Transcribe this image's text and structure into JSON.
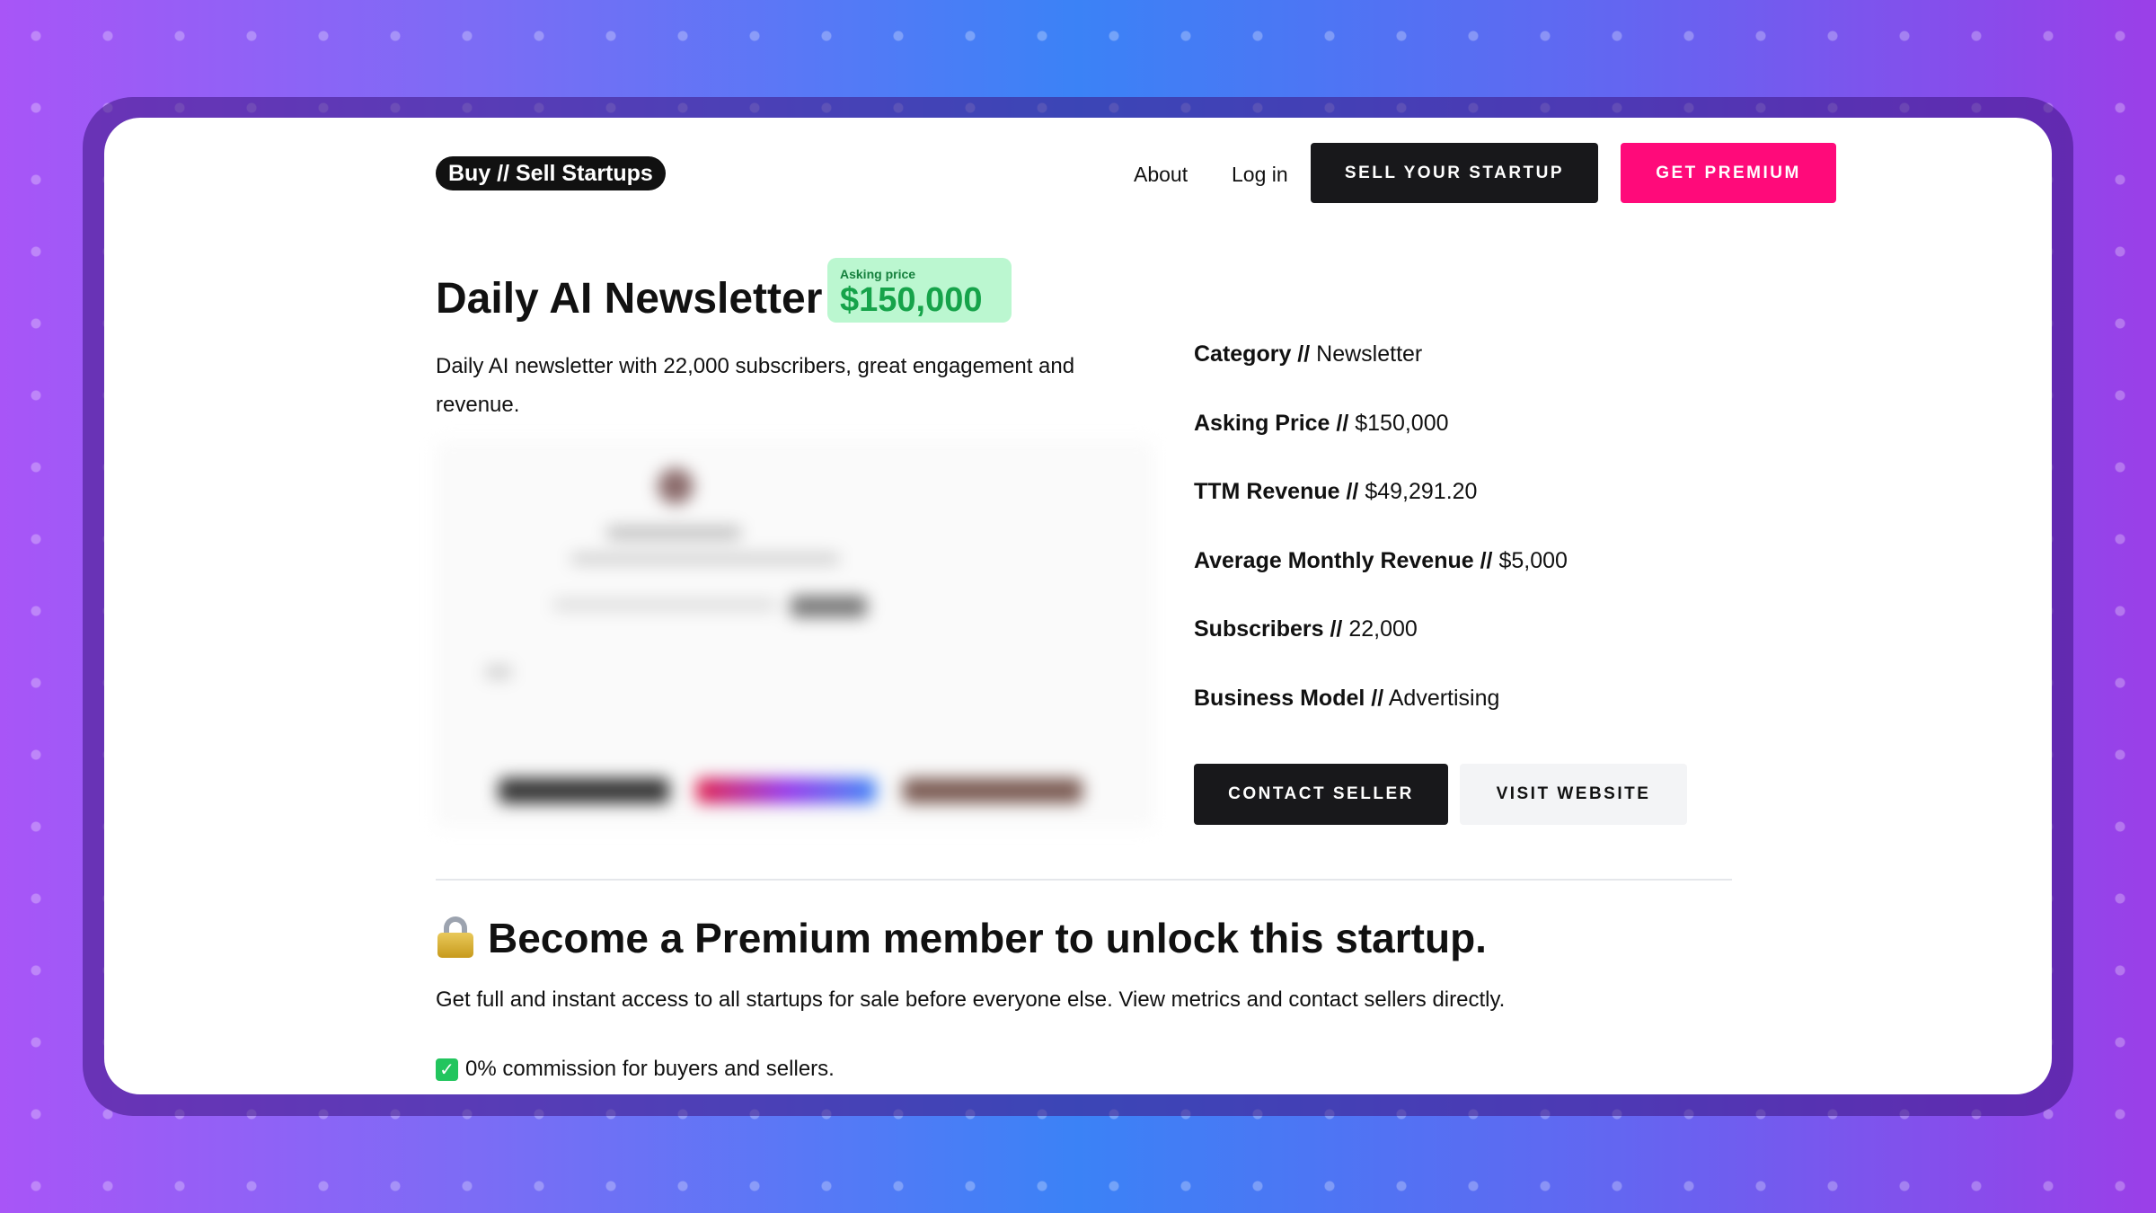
{
  "header": {
    "logo": "Buy // Sell Startups",
    "nav_about": "About",
    "nav_login": "Log in",
    "sell_button": "SELL YOUR STARTUP",
    "premium_button": "GET PREMIUM"
  },
  "listing": {
    "title": "Daily AI Newsletter",
    "asking_price_label": "Asking price",
    "asking_price": "$150,000",
    "description": "Daily AI newsletter with 22,000 subscribers, great engagement and revenue."
  },
  "details": [
    {
      "key": "Category //",
      "value": "Newsletter"
    },
    {
      "key": "Asking Price //",
      "value": "$150,000"
    },
    {
      "key": "TTM Revenue //",
      "value": "$49,291.20"
    },
    {
      "key": "Average Monthly Revenue //",
      "value": "$5,000"
    },
    {
      "key": "Subscribers //",
      "value": "22,000"
    },
    {
      "key": "Business Model //",
      "value": "Advertising"
    }
  ],
  "actions": {
    "contact": "CONTACT SELLER",
    "visit": "VISIT WEBSITE"
  },
  "premium": {
    "headline": "Become a Premium member to unlock this startup.",
    "subtext": "Get full and instant access to all startups for sale before everyone else. View metrics and contact sellers directly.",
    "benefit_1": "0% commission for buyers and sellers."
  },
  "colors": {
    "accent_pink": "#ff0a7a",
    "price_green": "#16a34a",
    "price_badge_bg": "#bbf7d0",
    "dark_button": "#18181b"
  },
  "icons": [
    "lock-icon",
    "check-icon"
  ]
}
